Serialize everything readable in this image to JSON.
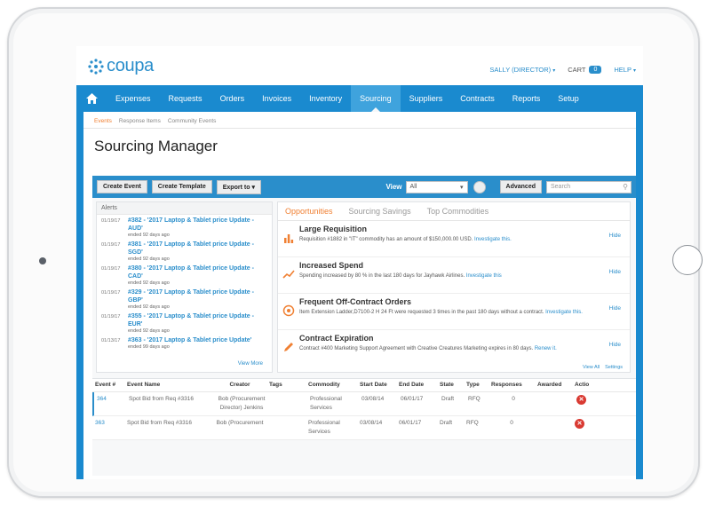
{
  "app": {
    "logo_text": "coupa",
    "user_menu": "SALLY (DIRECTOR)",
    "cart_label": "CART",
    "cart_count": "0",
    "help_label": "HELP"
  },
  "nav": {
    "items": [
      {
        "label": "Expenses"
      },
      {
        "label": "Requests"
      },
      {
        "label": "Orders"
      },
      {
        "label": "Invoices"
      },
      {
        "label": "Inventory"
      },
      {
        "label": "Sourcing"
      },
      {
        "label": "Suppliers"
      },
      {
        "label": "Contracts"
      },
      {
        "label": "Reports"
      },
      {
        "label": "Setup"
      }
    ],
    "active": "Sourcing"
  },
  "subtabs": [
    "Events",
    "Response Items",
    "Community Events"
  ],
  "page_title": "Sourcing Manager",
  "toolbar": {
    "create_event": "Create Event",
    "create_template": "Create Template",
    "export_to": "Export to",
    "view_label": "View",
    "view_value": "All",
    "advanced": "Advanced",
    "search_placeholder": "Search"
  },
  "alerts": {
    "header": "Alerts",
    "items": [
      {
        "date": "01/19/17",
        "title": "#382 - '2017 Laptop & Tablet price Update - AUD'",
        "sub": "ended 92 days ago"
      },
      {
        "date": "01/19/17",
        "title": "#381 - '2017 Laptop & Tablet price Update - SGD'",
        "sub": "ended 92 days ago"
      },
      {
        "date": "01/19/17",
        "title": "#380 - '2017 Laptop & Tablet price Update - CAD'",
        "sub": "ended 92 days ago"
      },
      {
        "date": "01/19/17",
        "title": "#329 - '2017 Laptop & Tablet price Update - GBP'",
        "sub": "ended 92 days ago"
      },
      {
        "date": "01/19/17",
        "title": "#355 - '2017 Laptop & Tablet price Update - EUR'",
        "sub": "ended 92 days ago"
      },
      {
        "date": "01/13/17",
        "title": "#363 - '2017 Laptop & Tablet price Update'",
        "sub": "ended 99 days ago"
      }
    ],
    "view_more": "View More"
  },
  "opportunities": {
    "tabs": [
      "Opportunities",
      "Sourcing Savings",
      "Top Commodities"
    ],
    "cards": [
      {
        "title": "Large Requisition",
        "desc": "Requisition #1882 in \"IT\" commodity has an amount of $150,000.00 USD.",
        "link": "Investigate this.",
        "hide": "Hide",
        "icon": "bar-chart-icon"
      },
      {
        "title": "Increased Spend",
        "desc": "Spending increased by 80 % in the last 180 days for Jayhawk Airlines.",
        "link": "Investigate this",
        "hide": "Hide",
        "icon": "trend-line-icon"
      },
      {
        "title": "Frequent Off-Contract Orders",
        "desc": "Item Extension Ladder,D7100-2 H 24 Ft were requested 3 times in the past 180 days without a contract.",
        "link": "Investigate this.",
        "hide": "Hide",
        "icon": "target-icon"
      },
      {
        "title": "Contract Expiration",
        "desc": "Contract #400 Marketing Support Agreement with Creative Creatures Marketing expires in 80 days.",
        "link": "Renew it.",
        "hide": "Hide",
        "icon": "pencil-icon"
      }
    ],
    "view_all": "View All",
    "settings": "Settings"
  },
  "events_table": {
    "headers": [
      "Event #",
      "Event Name",
      "Creator",
      "Tags",
      "Commodity",
      "Start Date",
      "End Date",
      "State",
      "Type",
      "Responses",
      "Awarded",
      "Actio"
    ],
    "rows": [
      {
        "id": "364",
        "name": "Spot Bid from Req #3316",
        "creator": "Bob (Procurement Director) Jenkins",
        "tags": "",
        "commodity": "Professional Services",
        "start": "03/08/14",
        "end": "06/01/17",
        "state": "Draft",
        "type": "RFQ",
        "responses": "0",
        "awarded": ""
      },
      {
        "id": "363",
        "name": "Spot Bid from Req #3316",
        "creator": "Bob (Procurement",
        "tags": "",
        "commodity": "Professional Services",
        "start": "03/08/14",
        "end": "06/01/17",
        "state": "Draft",
        "type": "RFQ",
        "responses": "0",
        "awarded": ""
      }
    ]
  },
  "colors": {
    "brand_blue": "#1a8acf",
    "link_blue": "#2a8ecb",
    "accent_orange": "#f08033",
    "delete_red": "#d93a32"
  }
}
